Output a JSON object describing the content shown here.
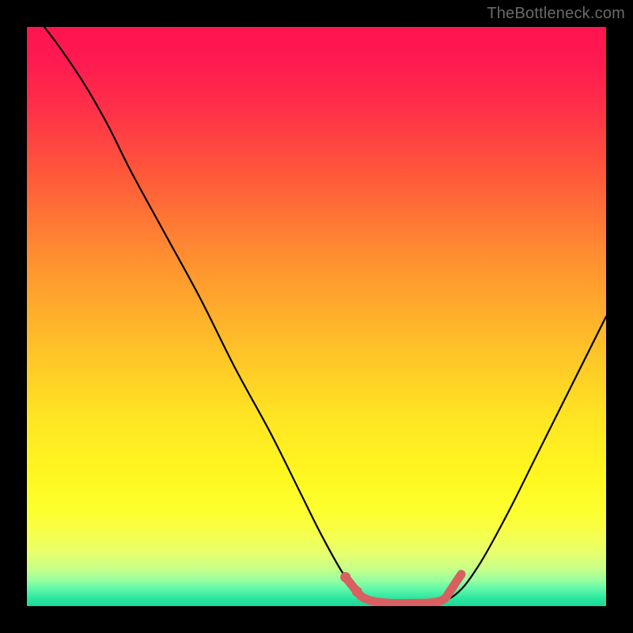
{
  "watermark": "TheBottleneck.com",
  "chart_data": {
    "type": "line",
    "title": "",
    "xlabel": "",
    "ylabel": "",
    "xlim": [
      0,
      100
    ],
    "ylim": [
      0,
      100
    ],
    "grid": false,
    "series": [
      {
        "name": "bottleneck-curve",
        "color": "#000000",
        "points": [
          {
            "x": 3,
            "y": 100
          },
          {
            "x": 6,
            "y": 96
          },
          {
            "x": 10,
            "y": 90
          },
          {
            "x": 14,
            "y": 83
          },
          {
            "x": 18,
            "y": 75
          },
          {
            "x": 24,
            "y": 64
          },
          {
            "x": 30,
            "y": 53
          },
          {
            "x": 36,
            "y": 41
          },
          {
            "x": 42,
            "y": 30
          },
          {
            "x": 47,
            "y": 20
          },
          {
            "x": 51,
            "y": 12
          },
          {
            "x": 55,
            "y": 5
          },
          {
            "x": 58,
            "y": 2
          },
          {
            "x": 62,
            "y": 0.5
          },
          {
            "x": 66,
            "y": 0.5
          },
          {
            "x": 70,
            "y": 0.5
          },
          {
            "x": 74,
            "y": 2
          },
          {
            "x": 78,
            "y": 7
          },
          {
            "x": 83,
            "y": 16
          },
          {
            "x": 88,
            "y": 26
          },
          {
            "x": 93,
            "y": 36
          },
          {
            "x": 100,
            "y": 50
          }
        ]
      },
      {
        "name": "optimal-range-marker",
        "color": "#d86060",
        "points": [
          {
            "x": 55,
            "y": 5
          },
          {
            "x": 57,
            "y": 2.5
          },
          {
            "x": 58,
            "y": 1.5
          },
          {
            "x": 60,
            "y": 0.8
          },
          {
            "x": 63,
            "y": 0.5
          },
          {
            "x": 67,
            "y": 0.5
          },
          {
            "x": 70,
            "y": 0.6
          },
          {
            "x": 72,
            "y": 1.2
          },
          {
            "x": 73,
            "y": 2.5
          },
          {
            "x": 74,
            "y": 4
          },
          {
            "x": 75,
            "y": 5.5
          }
        ]
      }
    ],
    "marker_dots": [
      {
        "x": 55,
        "y": 5
      },
      {
        "x": 57,
        "y": 2.5
      }
    ],
    "color_key": {
      "description": "vertical gradient background indicating bottleneck severity, red = high, green = low",
      "stops": [
        {
          "pos": 0,
          "color": "#ff1450"
        },
        {
          "pos": 50,
          "color": "#ffc028"
        },
        {
          "pos": 85,
          "color": "#fcff30"
        },
        {
          "pos": 100,
          "color": "#18d898"
        }
      ]
    }
  }
}
